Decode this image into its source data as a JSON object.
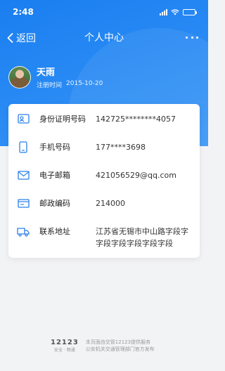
{
  "status_bar": {
    "time": "2:48"
  },
  "nav": {
    "back_label": "返回",
    "title": "个人中心"
  },
  "profile": {
    "name": "天雨",
    "reg_label": "注册时间",
    "reg_date": "2015-10-20"
  },
  "details": [
    {
      "icon": "id-card-icon",
      "label": "身份证明号码",
      "value": "142725********4057"
    },
    {
      "icon": "phone-icon",
      "label": "手机号码",
      "value": "177****3698"
    },
    {
      "icon": "mail-icon",
      "label": "电子邮箱",
      "value": "421056529@qq.com"
    },
    {
      "icon": "postcode-icon",
      "label": "邮政编码",
      "value": "214000"
    },
    {
      "icon": "truck-icon",
      "label": "联系地址",
      "value": "江苏省无锡市中山路字段字字段字段字段字段字段"
    }
  ],
  "footer": {
    "logo_text": "12123",
    "logo_sub": "安全 · 畅通",
    "line1": "本页面由交管12123提供服务",
    "line2": "公安机关交通管理部门官方发布"
  },
  "colors": {
    "primary": "#1a7ef0",
    "icon": "#2a7fe8"
  }
}
